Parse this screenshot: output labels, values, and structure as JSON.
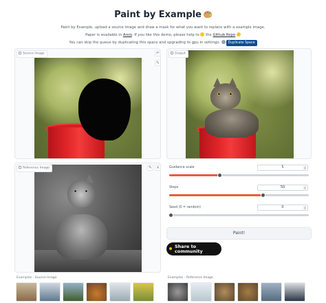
{
  "header": {
    "title": "Paint by Example",
    "line1": "Paint by Example, upload a source image and draw a mask for what you want to replace with a example image.",
    "line2_prefix": "Paper is available in ",
    "line2_arxiv": "Arxiv",
    "line2_mid": ". If you like this demo, please help to ",
    "line2_github": "Github Repo",
    "line3_prefix": "You can skip the queue by duplicating this space and upgrading to gpu in settings: ",
    "duplicate_label": "Duplicate Space"
  },
  "panels": {
    "source": {
      "label": "Source Image",
      "undo_icon": "undo-icon",
      "close_icon": "close-icon",
      "brush_icon": "brush-icon"
    },
    "output": {
      "label": "Output"
    },
    "reference": {
      "label": "Reference Image",
      "edit_icon": "pencil-icon",
      "close_icon": "close-icon"
    }
  },
  "controls": {
    "guidance": {
      "label": "Guidance scale",
      "value": "5",
      "fraction": 0.36
    },
    "steps": {
      "label": "Steps",
      "value": "50",
      "fraction": 0.67
    },
    "seed": {
      "label": "Seed (0 = random)",
      "value": "0",
      "fraction": 0.0
    }
  },
  "buttons": {
    "paint": "Paint!",
    "share": "Share to community"
  },
  "examples": {
    "source_label": "Examples - Source Image",
    "reference_label": "Examples - Reference Image"
  },
  "colors": {
    "slider_fill": "#e85d3a",
    "duplicate_badge": "#0f4c92"
  }
}
